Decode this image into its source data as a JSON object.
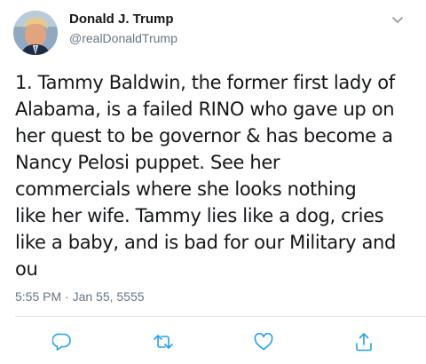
{
  "tweet": {
    "author": {
      "display_name": "Donald J. Trump",
      "handle": "@realDonaldTrump",
      "avatar_icon": "profile-photo"
    },
    "menu_icon": "chevron-down-icon",
    "text": "1. Tammy Baldwin, the former first lady of\nAlabama, is a failed RINO who gave up on\nher quest to be governor & has become a\nNancy Pelosi puppet. See her\ncommercials where she looks nothing\nlike her wife. Tammy lies like a dog, cries\nlike a baby, and is bad for our Military and\nou",
    "timestamp": "5:55 PM · Jan 55, 5555",
    "actions": {
      "reply_icon": "reply-icon",
      "retweet_icon": "retweet-icon",
      "like_icon": "heart-icon",
      "share_icon": "share-icon"
    }
  },
  "colors": {
    "text": "#14171a",
    "secondary": "#657786",
    "icon": "#1da1f2",
    "divider": "#e1e8ed"
  }
}
